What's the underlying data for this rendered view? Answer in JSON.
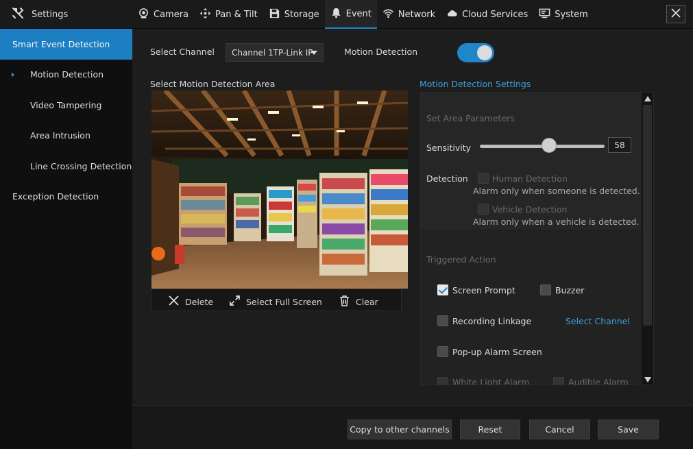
{
  "header": {
    "title": "Settings",
    "tabs": [
      {
        "label": "Camera",
        "icon": "camera-icon"
      },
      {
        "label": "Pan & Tilt",
        "icon": "pan-tilt-icon"
      },
      {
        "label": "Storage",
        "icon": "storage-icon"
      },
      {
        "label": "Event",
        "icon": "bell-icon",
        "active": true
      },
      {
        "label": "Network",
        "icon": "wifi-icon"
      },
      {
        "label": "Cloud Services",
        "icon": "cloud-icon"
      },
      {
        "label": "System",
        "icon": "monitor-icon"
      }
    ]
  },
  "sidebar": {
    "items": [
      {
        "label": "Smart Event Detection",
        "level": "top",
        "active": true
      },
      {
        "label": "Motion Detection",
        "level": "sub",
        "current": true
      },
      {
        "label": "Video Tampering",
        "level": "sub"
      },
      {
        "label": "Area Intrusion",
        "level": "sub"
      },
      {
        "label": "Line Crossing Detection",
        "level": "sub"
      },
      {
        "label": "Exception Detection",
        "level": "top"
      }
    ]
  },
  "main": {
    "channel_label": "Select Channel",
    "channel_value": "Channel 1TP-Link IP",
    "motion_label": "Motion Detection",
    "motion_enabled": true,
    "area_title": "Select Motion Detection Area",
    "tools": {
      "delete": "Delete",
      "full_screen": "Select Full Screen",
      "clear": "Clear"
    }
  },
  "settings": {
    "title": "Motion Detection Settings",
    "area_params": "Set Area Parameters",
    "sensitivity_label": "Sensitivity",
    "sensitivity_value": "58",
    "detection_label": "Detection",
    "human_label": "Human Detection",
    "human_help": "Alarm only when someone is detected.",
    "vehicle_label": "Vehicle Detection",
    "vehicle_help": "Alarm only when a vehicle is detected.",
    "triggered_title": "Triggered Action",
    "screen_prompt": "Screen Prompt",
    "screen_prompt_checked": true,
    "buzzer": "Buzzer",
    "recording_linkage": "Recording Linkage",
    "select_channel_link": "Select Channel",
    "popup_alarm": "Pop-up Alarm Screen",
    "white_light": "White Light Alarm",
    "audible_alarm": "Audible Alarm"
  },
  "footer": {
    "copy": "Copy to other channels",
    "reset": "Reset",
    "cancel": "Cancel",
    "save": "Save"
  },
  "colors": {
    "accent": "#1f86c7",
    "link": "#3fa0db",
    "background": "#1d1d1d"
  }
}
